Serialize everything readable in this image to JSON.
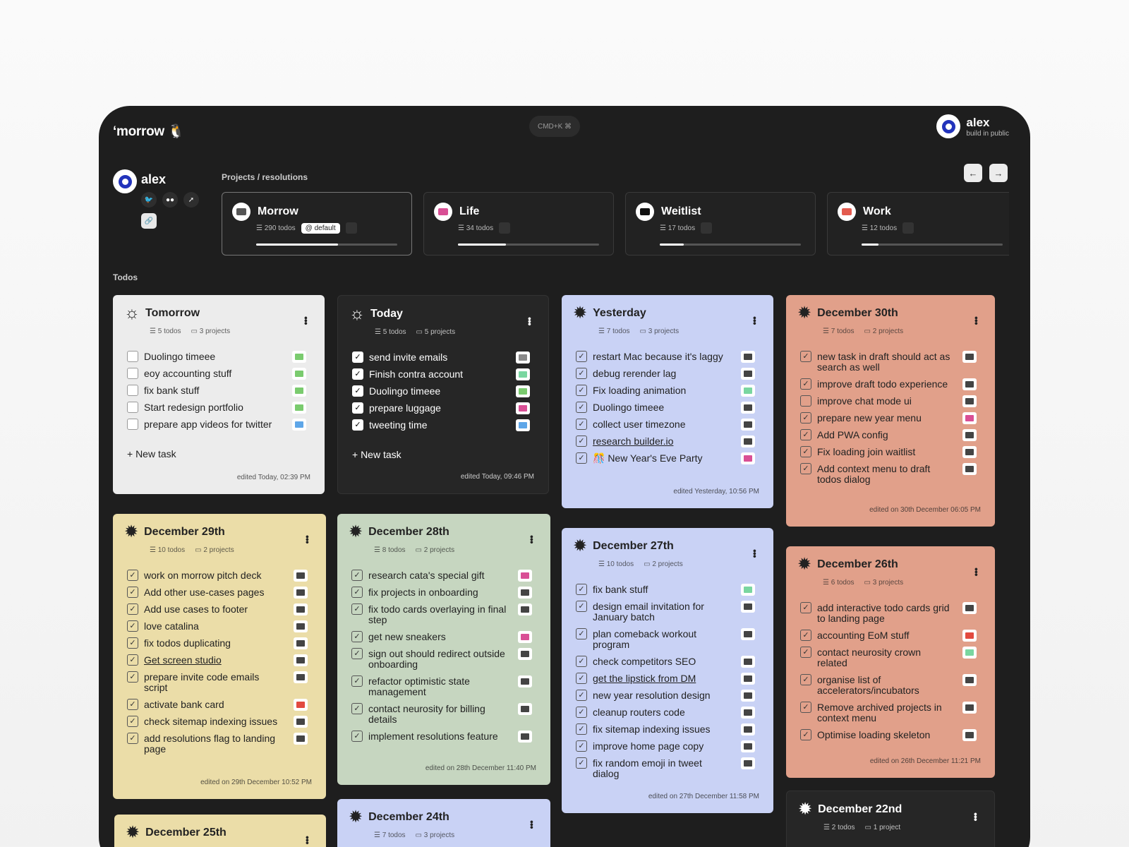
{
  "app": {
    "logo": "‘morrow",
    "cmdk": "CMD+K ⌘"
  },
  "user": {
    "name": "alex",
    "tagline": "build in public"
  },
  "breadcrumb": "Projects / resolutions",
  "todos_label": "Todos",
  "projects": [
    {
      "name": "Morrow",
      "todos": "290 todos",
      "badge": "default",
      "color": "#555555",
      "progress": 0.58
    },
    {
      "name": "Life",
      "todos": "34 todos",
      "color": "#d94f95",
      "progress": 0.34
    },
    {
      "name": "Weitlist",
      "todos": "17 todos",
      "color": "#111111",
      "progress": 0.17
    },
    {
      "name": "Work",
      "todos": "12 todos",
      "color": "#e35b4f",
      "progress": 0.12
    }
  ],
  "cards": {
    "tomorrow": {
      "title": "Tomorrow",
      "todos": "5 todos",
      "projects": "3 projects",
      "edited": "edited Today, 02:39 PM",
      "new_task": "New task",
      "items": [
        "Duolingo timeee",
        "eoy accounting stuff",
        "fix bank stuff",
        "Start redesign portfolio",
        "prepare app videos for twitter"
      ]
    },
    "today": {
      "title": "Today",
      "todos": "5 todos",
      "projects": "5 projects",
      "edited": "edited Today, 09:46 PM",
      "new_task": "New task",
      "items": [
        "send invite emails",
        "Finish contra account",
        "Duolingo timeee",
        "prepare luggage",
        "tweeting time"
      ]
    },
    "yesterday": {
      "title": "Yesterday",
      "todos": "7 todos",
      "projects": "3 projects",
      "edited": "edited Yesterday, 10:56 PM",
      "items": [
        "restart Mac because it's laggy",
        "debug rerender lag",
        "Fix loading animation",
        "Duolingo timeee",
        "collect user timezone",
        "research builder.io",
        "🎊 New Year's Eve Party"
      ]
    },
    "dec30": {
      "title": "December 30th",
      "todos": "7 todos",
      "projects": "2 projects",
      "edited": "edited on 30th December 06:05 PM",
      "items": [
        "new task in draft should act as search as well",
        "improve draft todo experience",
        "improve chat mode ui",
        "prepare new year menu",
        "Add PWA config",
        "Fix loading join waitlist",
        "Add context menu to draft todos dialog"
      ]
    },
    "dec29": {
      "title": "December 29th",
      "todos": "10 todos",
      "projects": "2 projects",
      "edited": "edited on 29th December 10:52 PM",
      "items": [
        "work on morrow pitch deck",
        "Add other use-cases pages",
        "Add use cases to footer",
        "love catalina",
        "fix todos duplicating",
        "Get screen studio",
        "prepare invite code emails script",
        "activate bank card",
        "check sitemap indexing issues",
        "add resolutions flag to landing page"
      ]
    },
    "dec28": {
      "title": "December 28th",
      "todos": "8 todos",
      "projects": "2 projects",
      "edited": "edited on 28th December 11:40 PM",
      "items": [
        "research cata's special gift",
        "fix projects in onboarding",
        "fix todo cards overlaying in final step",
        "get new sneakers",
        "sign out should redirect outside onboarding",
        "refactor optimistic state management",
        "contact neurosity for billing details",
        "implement resolutions feature"
      ]
    },
    "dec27": {
      "title": "December 27th",
      "todos": "10 todos",
      "projects": "2 projects",
      "edited": "edited on 27th December 11:58 PM",
      "items": [
        "fix bank stuff",
        "design email invitation for January batch",
        "plan comeback workout program",
        "check competitors SEO",
        "get the lipstick from DM",
        "new year resolution design",
        "cleanup routers code",
        "fix sitemap indexing issues",
        "improve home page copy",
        "fix random emoji in tweet dialog"
      ]
    },
    "dec26": {
      "title": "December 26th",
      "todos": "6 todos",
      "projects": "3 projects",
      "edited": "edited on 26th December 11:21 PM",
      "items": [
        "add interactive todo cards grid to landing page",
        "accounting EoM stuff",
        "contact neurosity crown related",
        "organise list of accelerators/incubators",
        "Remove archived projects in context menu",
        "Optimise loading skeleton"
      ]
    },
    "dec25": {
      "title": "December 25th"
    },
    "dec24": {
      "title": "December 24th",
      "todos": "7 todos",
      "projects": "3 projects"
    },
    "dec22": {
      "title": "December 22nd",
      "todos": "2 todos",
      "projects": "1 project"
    }
  }
}
